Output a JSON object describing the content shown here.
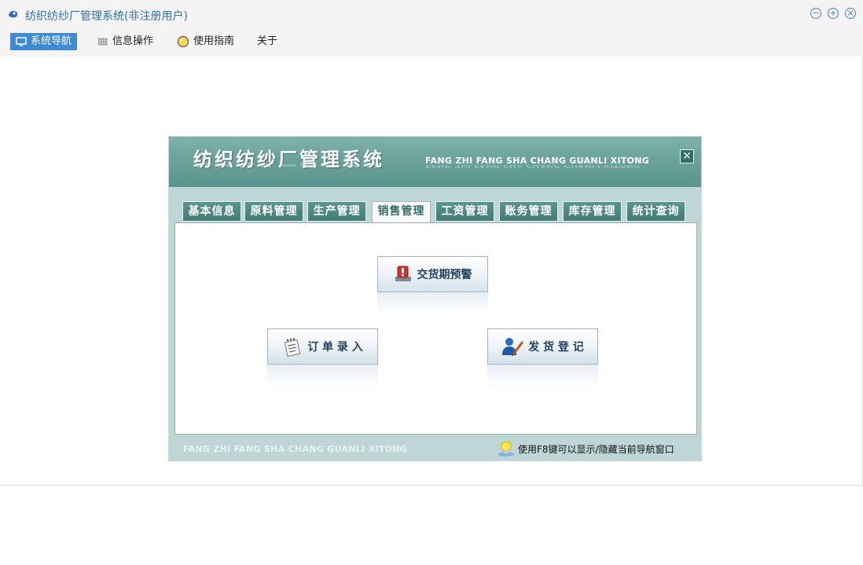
{
  "window": {
    "title": "纺织纺纱厂管理系统(非注册用户)",
    "controls": [
      "minimize-icon",
      "restore-icon",
      "close-icon"
    ]
  },
  "menubar": {
    "items": [
      {
        "label": "系统导航",
        "icon": "monitor-icon",
        "active": true
      },
      {
        "label": "信息操作",
        "icon": "grid-icon",
        "active": false
      },
      {
        "label": "使用指南",
        "icon": "bulb-icon",
        "active": false
      },
      {
        "label": "关于",
        "icon": "",
        "active": false
      }
    ]
  },
  "panel": {
    "title_cn": "纺织纺纱厂管理系统",
    "title_en": "FANG ZHI FANG SHA CHANG GUANLI XITONG",
    "tabs": [
      "基本信息",
      "原料管理",
      "生产管理",
      "销售管理",
      "工资管理",
      "账务管理",
      "库存管理",
      "统计查询"
    ],
    "active_tab": "销售管理",
    "buttons": {
      "delivery_warning": "交货期预警",
      "order_entry": "订 单 录 入",
      "shipping_register": "发 货 登 记"
    },
    "footer_en": "FANG ZHI FANG SHA CHANG GUANLI XITONG",
    "footer_tip": "使用F8键可以显示/隐藏当前导航窗口"
  },
  "colors": {
    "accent": "#3d8bd8",
    "panel_teal": "#5a938d",
    "panel_bg": "#bfd6d6"
  }
}
